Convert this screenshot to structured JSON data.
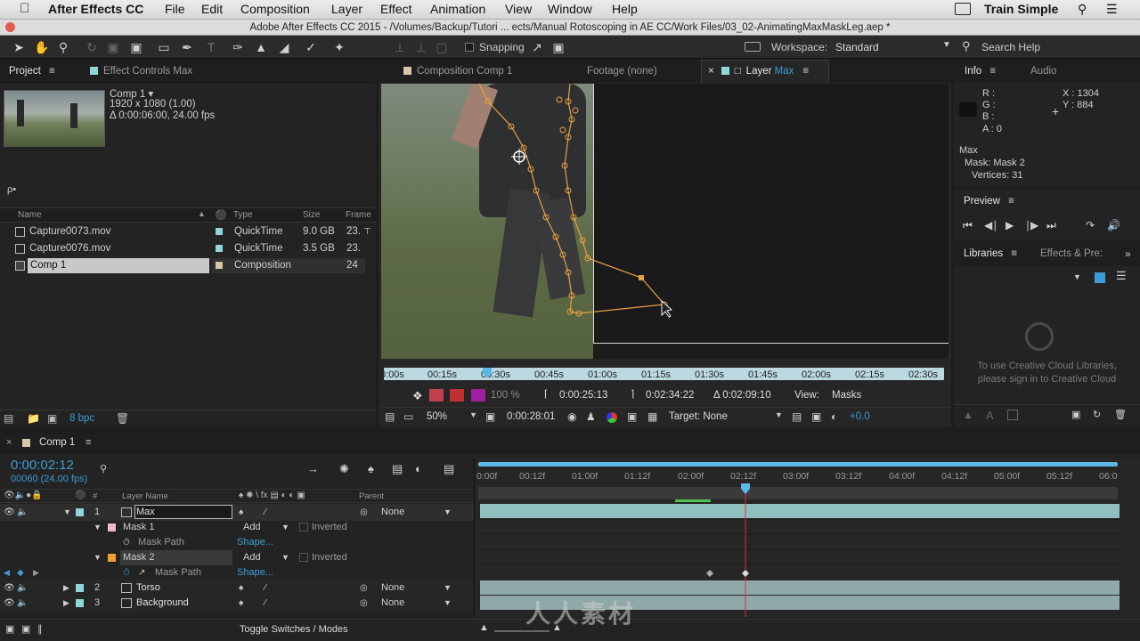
{
  "menubar": {
    "app": "After Effects CC",
    "items": [
      "File",
      "Edit",
      "Composition",
      "Layer",
      "Effect",
      "Animation",
      "View",
      "Window",
      "Help"
    ],
    "right_label": "Train Simple"
  },
  "window_title": "Adobe After Effects CC 2015 - /Volumes/Backup/Tutori ... ects/Manual Rotoscoping in AE CC/Work Files/03_02-AnimatingMaxMaskLeg.aep *",
  "toolbar": {
    "snapping": "Snapping",
    "workspace_label": "Workspace:",
    "workspace_value": "Standard",
    "search_help": "Search Help"
  },
  "project": {
    "tab": "Project",
    "tab2": "Effect Controls Max",
    "comp_name": "Comp 1 ▾",
    "comp_res": "1920 x 1080 (1.00)",
    "comp_dur": "Δ 0:00:06:00, 24.00 fps",
    "search": "ρ•",
    "columns": [
      "Name",
      "Type",
      "Size",
      "Frame ..."
    ],
    "items": [
      {
        "name": "Capture0073.mov",
        "type": "QuickTime",
        "size": "9.0 GB",
        "frame": "23.",
        "color": "#8fd6d6"
      },
      {
        "name": "Capture0076.mov",
        "type": "QuickTime",
        "size": "3.5 GB",
        "frame": "23.",
        "color": "#8fd6d6"
      },
      {
        "name": "Comp 1",
        "type": "Composition",
        "size": "",
        "frame": "24",
        "color": "#d8c8a8"
      }
    ],
    "bpc": "8 bpc"
  },
  "viewer": {
    "tabs": [
      "Composition Comp 1",
      "Footage (none)",
      "Layer Max"
    ],
    "ruler": [
      "0:00s",
      "00:15s",
      "00:30s",
      "00:45s",
      "01:00s",
      "01:15s",
      "01:30s",
      "01:45s",
      "02:00s",
      "02:15s",
      "02:30s"
    ],
    "zoom_pct": "100 %",
    "in_time": "0:00:25:13",
    "out_time": "0:02:34:22",
    "dur": "Δ 0:02:09:10",
    "view_label": "View:",
    "view_value": "Masks",
    "mag": "50%",
    "current": "0:00:28:01",
    "target": "Target: None",
    "exposure": "+0.0"
  },
  "info": {
    "tab": "Info",
    "tab2": "Audio",
    "r": "R :",
    "g": "G :",
    "b": "B :",
    "a": "A : 0",
    "x": "X : 1304",
    "y": "Y : 884",
    "layer": "Max",
    "mask": "Mask: Mask 2",
    "vertices": "Vertices: 31"
  },
  "preview": {
    "tab": "Preview"
  },
  "libraries": {
    "tab": "Libraries",
    "tab2": "Effects & Pre:",
    "msg1": "To use Creative Cloud Libraries,",
    "msg2": "please sign in to Creative Cloud"
  },
  "timeline": {
    "tab": "Comp 1",
    "time": "0:00:02:12",
    "frames": "00060 (24.00 fps)",
    "ruler": [
      "0:00f",
      "00:12f",
      "01:00f",
      "01:12f",
      "02:00f",
      "02:12f",
      "03:00f",
      "03:12f",
      "04:00f",
      "04:12f",
      "05:00f",
      "05:12f",
      "06:0"
    ],
    "col_layer": "Layer Name",
    "col_parent": "Parent",
    "col_num": "#",
    "layers": [
      {
        "num": "1",
        "name": "Max",
        "mode": "Add",
        "parent": "None",
        "kind": "layer",
        "color": "#8fd6d6"
      },
      {
        "num": "",
        "name": "Mask 1",
        "mode": "Add",
        "parent": "Inverted",
        "kind": "mask",
        "color": "#f0b8c8"
      },
      {
        "num": "",
        "name": "Mask Path",
        "mode": "Shape...",
        "parent": "",
        "kind": "prop"
      },
      {
        "num": "",
        "name": "Mask 2",
        "mode": "Add",
        "parent": "Inverted",
        "kind": "mask",
        "color": "#f0a030"
      },
      {
        "num": "",
        "name": "Mask Path",
        "mode": "Shape...",
        "parent": "",
        "kind": "prop2"
      },
      {
        "num": "2",
        "name": "Torso",
        "mode": "",
        "parent": "None",
        "kind": "layer",
        "color": "#8fd6d6"
      },
      {
        "num": "3",
        "name": "Background",
        "mode": "",
        "parent": "None",
        "kind": "layer",
        "color": "#8fd6d6"
      }
    ],
    "toggle": "Toggle Switches / Modes"
  },
  "watermark": "人人素材"
}
